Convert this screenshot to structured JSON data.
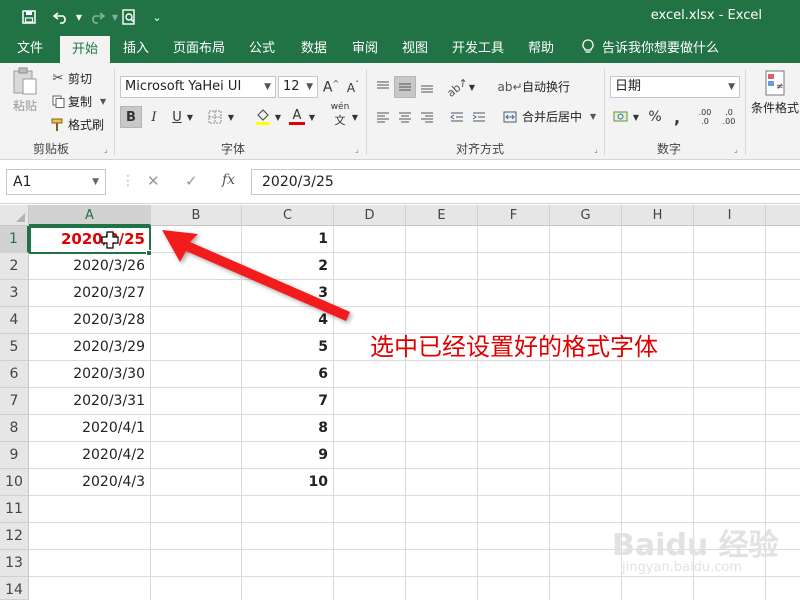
{
  "window": {
    "title": "excel.xlsx  -  Excel"
  },
  "quick_access": {
    "save_icon": "save-icon",
    "undo_icon": "undo-icon",
    "redo_icon": "redo-icon",
    "print_preview_icon": "print-preview-icon",
    "customize_icon": "customize-icon"
  },
  "tabs": [
    {
      "label": "文件"
    },
    {
      "label": "开始"
    },
    {
      "label": "插入"
    },
    {
      "label": "页面布局"
    },
    {
      "label": "公式"
    },
    {
      "label": "数据"
    },
    {
      "label": "审阅"
    },
    {
      "label": "视图"
    },
    {
      "label": "开发工具"
    },
    {
      "label": "帮助"
    },
    {
      "label": "告诉我你想要做什么"
    }
  ],
  "ribbon": {
    "clipboard": {
      "paste": "粘贴",
      "cut": "剪切",
      "copy": "复制",
      "format_painter": "格式刷",
      "label": "剪贴板"
    },
    "font": {
      "font_name": "Microsoft YaHei UI",
      "font_size": "12",
      "bold": "B",
      "italic": "I",
      "underline": "U",
      "font_color_letter": "A",
      "phonetic": "wén",
      "label": "字体"
    },
    "alignment": {
      "wrap_text": "自动换行",
      "merge_center": "合并后居中",
      "label": "对齐方式"
    },
    "number": {
      "format": "日期",
      "percent": "%",
      "comma": ",",
      "increase_decimal": ".00",
      "decrease_decimal": ".0",
      "label": "数字"
    },
    "styles": {
      "conditional_format": "条件格式"
    }
  },
  "formula_bar": {
    "name_box": "A1",
    "cancel": "✕",
    "enter": "✓",
    "fx": "fx",
    "formula": "2020/3/25"
  },
  "sheet": {
    "columns": [
      "A",
      "B",
      "C",
      "D",
      "E",
      "F",
      "G",
      "H",
      "I"
    ],
    "rows": [
      "1",
      "2",
      "3",
      "4",
      "5",
      "6",
      "7",
      "8",
      "9",
      "10",
      "11",
      "12",
      "13",
      "14"
    ],
    "col_a": [
      "2020/3/25",
      "2020/3/26",
      "2020/3/27",
      "2020/3/28",
      "2020/3/29",
      "2020/3/30",
      "2020/3/31",
      "2020/4/1",
      "2020/4/2",
      "2020/4/3"
    ],
    "col_c": [
      "1",
      "2",
      "3",
      "4",
      "5",
      "6",
      "7",
      "8",
      "9",
      "10"
    ]
  },
  "annotation": {
    "text": "选中已经设置好的格式字体",
    "color": "#e00000"
  },
  "watermark": {
    "text": "Baidu 经验",
    "sub": "jingyan.baidu.com"
  },
  "colors": {
    "excel_green": "#217346",
    "annotation_red": "#e00000"
  }
}
